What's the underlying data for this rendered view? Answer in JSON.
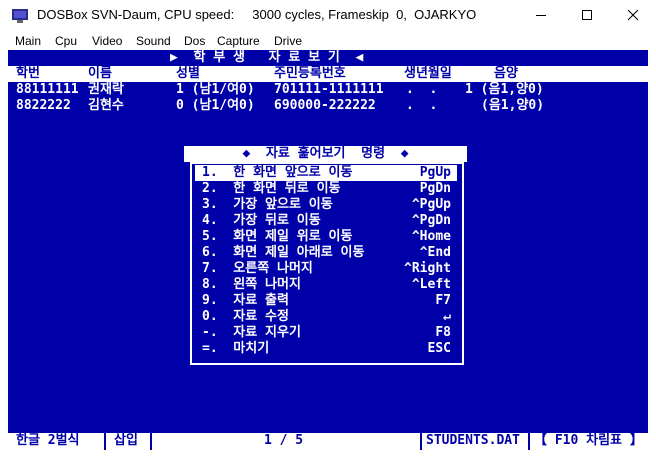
{
  "window": {
    "title": "DOSBox SVN-Daum, CPU speed:     3000 cycles, Frameskip  0,  OJARKYO",
    "minimize_icon": "minimize-icon",
    "maximize_icon": "maximize-icon",
    "close_icon": "close-icon"
  },
  "menu": [
    "Main",
    "Cpu",
    "Video",
    "Sound",
    "Dos",
    "Capture",
    "Drive"
  ],
  "screen": {
    "header_title": "▶  학 부 생   자 료 보 기  ◀",
    "columns": [
      "학번",
      "이름",
      "성별",
      "주민등록번호",
      "생년월일",
      "음양"
    ],
    "records": [
      {
        "id": "88111111",
        "name": "권재락",
        "sex": "1 (남1/여0)",
        "ssn": "701111-1111111",
        "birth": ".  .",
        "lunar": "1 (음1,양0)"
      },
      {
        "id": "8822222",
        "name": "김현수",
        "sex": "0 (남1/여0)",
        "ssn": "690000-222222",
        "birth": ".  .",
        "lunar": "(음1,양0)"
      }
    ],
    "dialog": {
      "title": "◆  자료 훑어보기  명령  ◆",
      "items": [
        {
          "label": "1.  한 화면 앞으로 이동",
          "key": "PgUp"
        },
        {
          "label": "2.  한 화면 뒤로 이동",
          "key": "PgDn"
        },
        {
          "label": "3.  가장 앞으로 이동",
          "key": "^PgUp"
        },
        {
          "label": "4.  가장 뒤로 이동",
          "key": "^PgDn"
        },
        {
          "label": "5.  화면 제일 위로 이동",
          "key": "^Home"
        },
        {
          "label": "6.  화면 제일 아래로 이동",
          "key": "^End"
        },
        {
          "label": "7.  오른쪽 나머지",
          "key": "^Right"
        },
        {
          "label": "8.  왼쪽 나머지",
          "key": "^Left"
        },
        {
          "label": "9.  자료 출력",
          "key": "F7"
        },
        {
          "label": "0.  자료 수정",
          "key": "↵"
        },
        {
          "label": "-.  자료 지우기",
          "key": "F8"
        },
        {
          "label": "=.  마치기",
          "key": "ESC"
        }
      ]
    },
    "status": {
      "input_mode": "한글 2벌식",
      "insert_mode": "삽입",
      "page": "1 / 5",
      "file": "STUDENTS.DAT",
      "help": "【 F10 차림표 】"
    }
  }
}
